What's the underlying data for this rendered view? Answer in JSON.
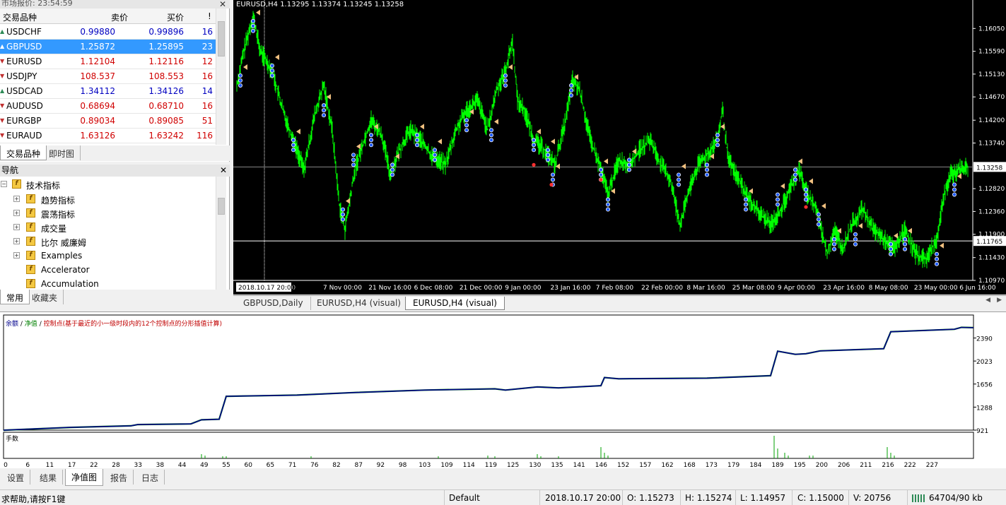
{
  "market_watch": {
    "title": "市场报价: 23:54:59",
    "columns": {
      "symbol": "交易品种",
      "bid": "卖价",
      "ask": "买价",
      "spread": "!"
    },
    "rows": [
      {
        "symbol": "USDCHF",
        "bid": "0.99880",
        "ask": "0.99896",
        "spread": "16",
        "color": "#0000c0",
        "dir": "up"
      },
      {
        "symbol": "GBPUSD",
        "bid": "1.25872",
        "ask": "1.25895",
        "spread": "23",
        "color": "#0000c0",
        "dir": "up",
        "selected": true
      },
      {
        "symbol": "EURUSD",
        "bid": "1.12104",
        "ask": "1.12116",
        "spread": "12",
        "color": "#d00000",
        "dir": "down"
      },
      {
        "symbol": "USDJPY",
        "bid": "108.537",
        "ask": "108.553",
        "spread": "16",
        "color": "#d00000",
        "dir": "down"
      },
      {
        "symbol": "USDCAD",
        "bid": "1.34112",
        "ask": "1.34126",
        "spread": "14",
        "color": "#0000c0",
        "dir": "up"
      },
      {
        "symbol": "AUDUSD",
        "bid": "0.68694",
        "ask": "0.68710",
        "spread": "16",
        "color": "#d00000",
        "dir": "down"
      },
      {
        "symbol": "EURGBP",
        "bid": "0.89034",
        "ask": "0.89085",
        "spread": "51",
        "color": "#d00000",
        "dir": "down"
      },
      {
        "symbol": "EURAUD",
        "bid": "1.63126",
        "ask": "1.63242",
        "spread": "116",
        "color": "#d00000",
        "dir": "down"
      }
    ],
    "tabs": [
      "交易品种",
      "即时图"
    ]
  },
  "navigator": {
    "title": "导航",
    "root": "技术指标",
    "items": [
      "趋势指标",
      "震荡指标",
      "成交量",
      "比尔 威廉姆",
      "Examples",
      "Accelerator",
      "Accumulation"
    ],
    "tabs": [
      "常用",
      "收藏夹"
    ]
  },
  "chart": {
    "header": "EURUSD,H4  1.13295 1.13374 1.13245 1.13258",
    "price_levels": [
      "1.16050",
      "1.15590",
      "1.15130",
      "1.14670",
      "1.14200",
      "1.13740",
      "1.12820",
      "1.12360",
      "1.11900",
      "1.11430",
      "1.10970"
    ],
    "current_price": "1.13258",
    "crosshair_price": "1.11765",
    "time_labels": [
      "ct 08:00",
      "7 Nov 00:00",
      "21 Nov 16:00",
      "6 Dec 08:00",
      "21 Dec 00:00",
      "9 Jan 00:00",
      "23 Jan 16:00",
      "7 Feb 08:00",
      "22 Feb 00:00",
      "8 Mar 16:00",
      "25 Mar 08:00",
      "9 Apr 00:00",
      "23 Apr 16:00",
      "8 May 08:00",
      "23 May 00:00",
      "6 Jun 16:00"
    ],
    "crosshair_time": "2018.10.17 20:00",
    "axis_min": 1.1097,
    "axis_max": 1.1651,
    "bull_color": "#00ff00",
    "tabs": [
      "GBPUSD,Daily",
      "EURUSD,H4 (visual)",
      "EURUSD,H4 (visual)"
    ]
  },
  "equity": {
    "legend_balance": "余额",
    "legend_equity": "净值",
    "legend_note": "控制点(基于最近的小一级时段内的12个控制点的分形插值计算)",
    "y_labels": [
      "2390",
      "2023",
      "1656",
      "1288",
      "921"
    ],
    "volume_label": "手数",
    "x_labels": [
      "0",
      "6",
      "11",
      "17",
      "22",
      "28",
      "33",
      "38",
      "44",
      "49",
      "55",
      "60",
      "65",
      "71",
      "76",
      "82",
      "87",
      "92",
      "98",
      "103",
      "109",
      "114",
      "119",
      "125",
      "130",
      "135",
      "141",
      "146",
      "152",
      "157",
      "162",
      "168",
      "173",
      "179",
      "184",
      "189",
      "195",
      "200",
      "206",
      "211",
      "216",
      "222",
      "227"
    ],
    "balance_color": "#00008b",
    "equity_color": "#008000"
  },
  "bottom_tabs": [
    "设置",
    "结果",
    "净值图",
    "报告",
    "日志"
  ],
  "status": {
    "help": "求帮助,请按F1键",
    "profile": "Default",
    "datetime": "2018.10.17 20:00",
    "open": "O: 1.15273",
    "high": "H: 1.15274",
    "low": "L: 1.14957",
    "close": "C: 1.15000",
    "volume": "V: 20756",
    "traffic": "64704/90 kb"
  }
}
